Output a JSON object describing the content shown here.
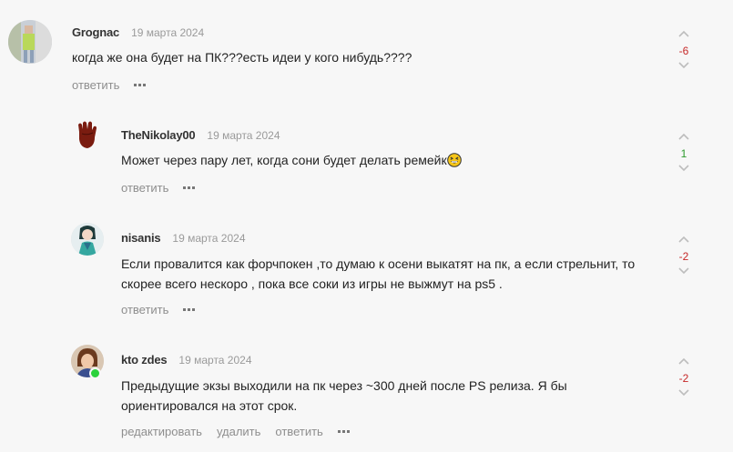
{
  "comments": [
    {
      "author": "Grognac",
      "date": "19 марта 2024",
      "lines": [
        "когда же она будет на ПК???есть идеи у кого нибудь????"
      ],
      "actions": [
        "ответить"
      ],
      "score": "-6",
      "avatar_icon": "user-photo-avatar"
    },
    {
      "author": "TheNikolay00",
      "date": "19 марта 2024",
      "lines": [
        "Может через пару лет, когда сони будет делать ремейк"
      ],
      "emoji": "grinning-squint-emoji",
      "actions": [
        "ответить"
      ],
      "score": "1",
      "avatar_icon": "glove-avatar"
    },
    {
      "author": "nisanis",
      "date": "19 марта 2024",
      "lines": [
        "Если провалится как форчпокен ,то думаю к осени выкатят на пк, а если стрельнит, то",
        "скорее всего нескоро , пока все соки из игры не выжмут на ps5 ."
      ],
      "actions": [
        "ответить"
      ],
      "score": "-2",
      "avatar_icon": "anime-character-avatar"
    },
    {
      "author": "kto zdes",
      "date": "19 марта 2024",
      "lines": [
        "Предыдущие экзы выходили на пк через ~300 дней после PS релиза. Я бы",
        "ориентировался на этот срок."
      ],
      "actions": [
        "редактировать",
        "удалить",
        "ответить"
      ],
      "score": "-2",
      "avatar_icon": "portrait-avatar",
      "online": true
    }
  ],
  "colors": {
    "background": "#f7f7f7",
    "negative_score": "#c62828",
    "positive_score": "#2e9a2e",
    "online": "#2bd23c"
  }
}
